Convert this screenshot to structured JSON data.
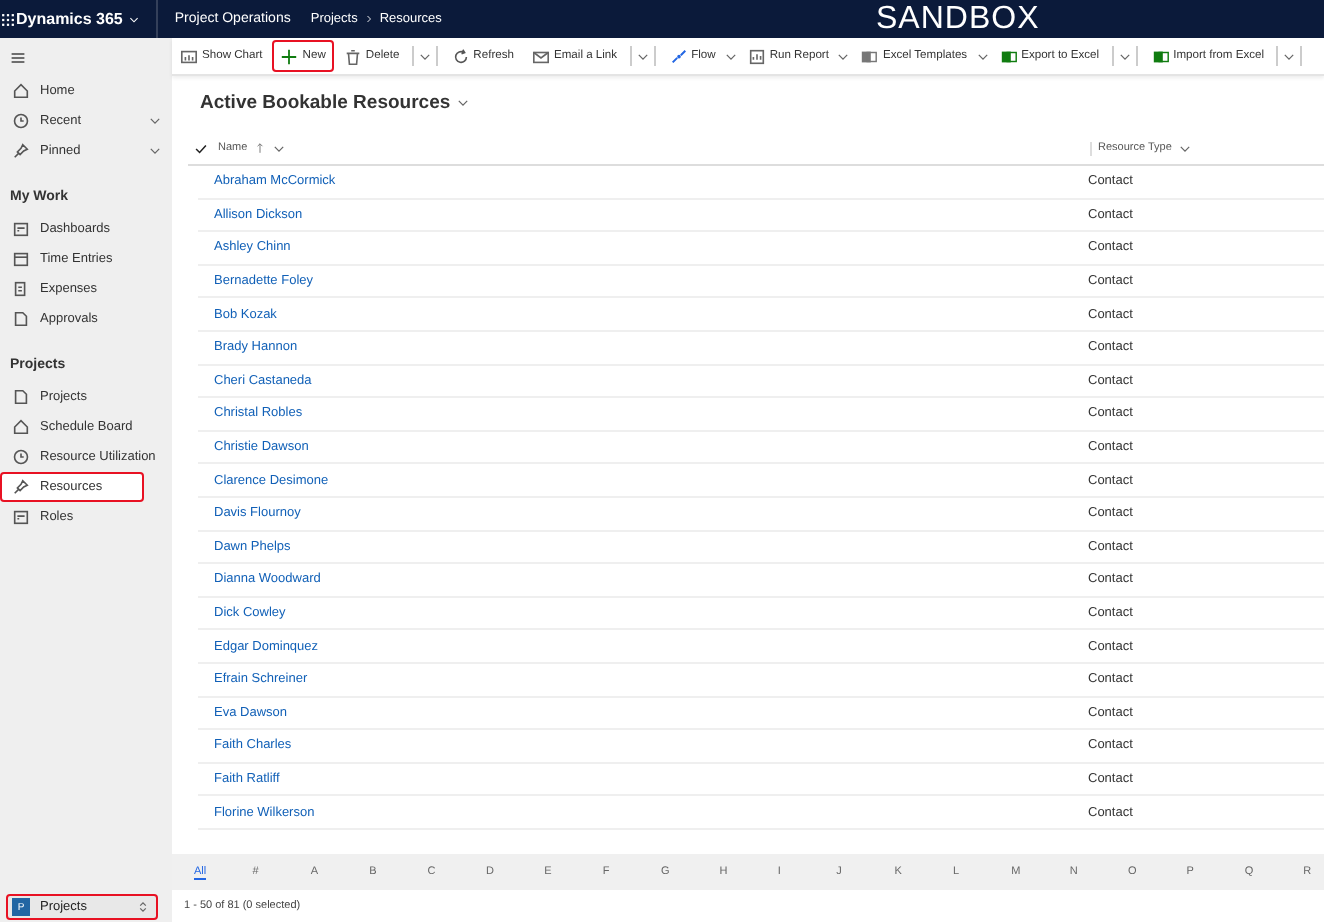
{
  "top_bar": {
    "app_name": "Dynamics 365",
    "area": "Project Operations",
    "breadcrumb": [
      "Projects",
      "Resources"
    ],
    "banner": "SANDBOX"
  },
  "sidebar": {
    "sections": [
      {
        "items": [
          {
            "label": "Home",
            "kind": "link",
            "selected": false,
            "highlighted": false
          },
          {
            "label": "Recent",
            "kind": "group",
            "selected": false,
            "highlighted": false
          },
          {
            "label": "Pinned",
            "kind": "group",
            "selected": false,
            "highlighted": false
          }
        ]
      },
      {
        "heading": "My Work",
        "items": [
          {
            "label": "Dashboards",
            "kind": "link",
            "selected": false,
            "highlighted": false
          },
          {
            "label": "Time Entries",
            "kind": "link",
            "selected": false,
            "highlighted": false
          },
          {
            "label": "Expenses",
            "kind": "link",
            "selected": false,
            "highlighted": false
          },
          {
            "label": "Approvals",
            "kind": "link",
            "selected": false,
            "highlighted": false
          }
        ]
      },
      {
        "heading": "Projects",
        "items": [
          {
            "label": "Projects",
            "kind": "link",
            "selected": false,
            "highlighted": false
          },
          {
            "label": "Schedule Board",
            "kind": "link",
            "selected": false,
            "highlighted": false
          },
          {
            "label": "Resource Utilization",
            "kind": "link",
            "selected": false,
            "highlighted": false
          },
          {
            "label": "Resources",
            "kind": "link",
            "selected": true,
            "highlighted": true
          },
          {
            "label": "Roles",
            "kind": "link",
            "selected": false,
            "highlighted": false
          }
        ]
      }
    ],
    "area_switcher": {
      "badge": "P",
      "label": "Projects",
      "highlighted": true
    }
  },
  "commands": [
    {
      "label": "Show Chart",
      "kind": "button",
      "highlighted": false
    },
    {
      "label": "New",
      "kind": "button",
      "highlighted": true
    },
    {
      "label": "Delete",
      "kind": "split",
      "highlighted": false
    },
    {
      "label": "Refresh",
      "kind": "button",
      "highlighted": false
    },
    {
      "label": "Email a Link",
      "kind": "split",
      "highlighted": false
    },
    {
      "label": "Flow",
      "kind": "menu",
      "highlighted": false
    },
    {
      "label": "Run Report",
      "kind": "menu",
      "highlighted": false
    },
    {
      "label": "Excel Templates",
      "kind": "menu",
      "highlighted": false
    },
    {
      "label": "Export to Excel",
      "kind": "split",
      "highlighted": false
    },
    {
      "label": "Import from Excel",
      "kind": "split",
      "highlighted": false
    }
  ],
  "view": {
    "title": "Active Bookable Resources",
    "columns": [
      {
        "label": "Name",
        "sorted": true
      },
      {
        "label": "Resource Type",
        "sorted": false
      }
    ],
    "rows": [
      {
        "name": "Abraham McCormick",
        "resource_type": "Contact"
      },
      {
        "name": "Allison Dickson",
        "resource_type": "Contact"
      },
      {
        "name": "Ashley Chinn",
        "resource_type": "Contact"
      },
      {
        "name": "Bernadette Foley",
        "resource_type": "Contact"
      },
      {
        "name": "Bob Kozak",
        "resource_type": "Contact"
      },
      {
        "name": "Brady Hannon",
        "resource_type": "Contact"
      },
      {
        "name": "Cheri Castaneda",
        "resource_type": "Contact"
      },
      {
        "name": "Christal Robles",
        "resource_type": "Contact"
      },
      {
        "name": "Christie Dawson",
        "resource_type": "Contact"
      },
      {
        "name": "Clarence Desimone",
        "resource_type": "Contact"
      },
      {
        "name": "Davis Flournoy",
        "resource_type": "Contact"
      },
      {
        "name": "Dawn Phelps",
        "resource_type": "Contact"
      },
      {
        "name": "Dianna Woodward",
        "resource_type": "Contact"
      },
      {
        "name": "Dick Cowley",
        "resource_type": "Contact"
      },
      {
        "name": "Edgar Dominquez",
        "resource_type": "Contact"
      },
      {
        "name": "Efrain Schreiner",
        "resource_type": "Contact"
      },
      {
        "name": "Eva Dawson",
        "resource_type": "Contact"
      },
      {
        "name": "Faith Charles",
        "resource_type": "Contact"
      },
      {
        "name": "Faith Ratliff",
        "resource_type": "Contact"
      },
      {
        "name": "Florine Wilkerson",
        "resource_type": "Contact"
      }
    ]
  },
  "alphabet": [
    {
      "label": "All",
      "selected": true
    },
    {
      "label": "#",
      "selected": false
    },
    {
      "label": "A",
      "selected": false
    },
    {
      "label": "B",
      "selected": false
    },
    {
      "label": "C",
      "selected": false
    },
    {
      "label": "D",
      "selected": false
    },
    {
      "label": "E",
      "selected": false
    },
    {
      "label": "F",
      "selected": false
    },
    {
      "label": "G",
      "selected": false
    },
    {
      "label": "H",
      "selected": false
    },
    {
      "label": "I",
      "selected": false
    },
    {
      "label": "J",
      "selected": false
    },
    {
      "label": "K",
      "selected": false
    },
    {
      "label": "L",
      "selected": false
    },
    {
      "label": "M",
      "selected": false
    },
    {
      "label": "N",
      "selected": false
    },
    {
      "label": "O",
      "selected": false
    },
    {
      "label": "P",
      "selected": false
    },
    {
      "label": "Q",
      "selected": false
    },
    {
      "label": "R",
      "selected": false
    }
  ],
  "status": "1 - 50 of 81 (0 selected)"
}
